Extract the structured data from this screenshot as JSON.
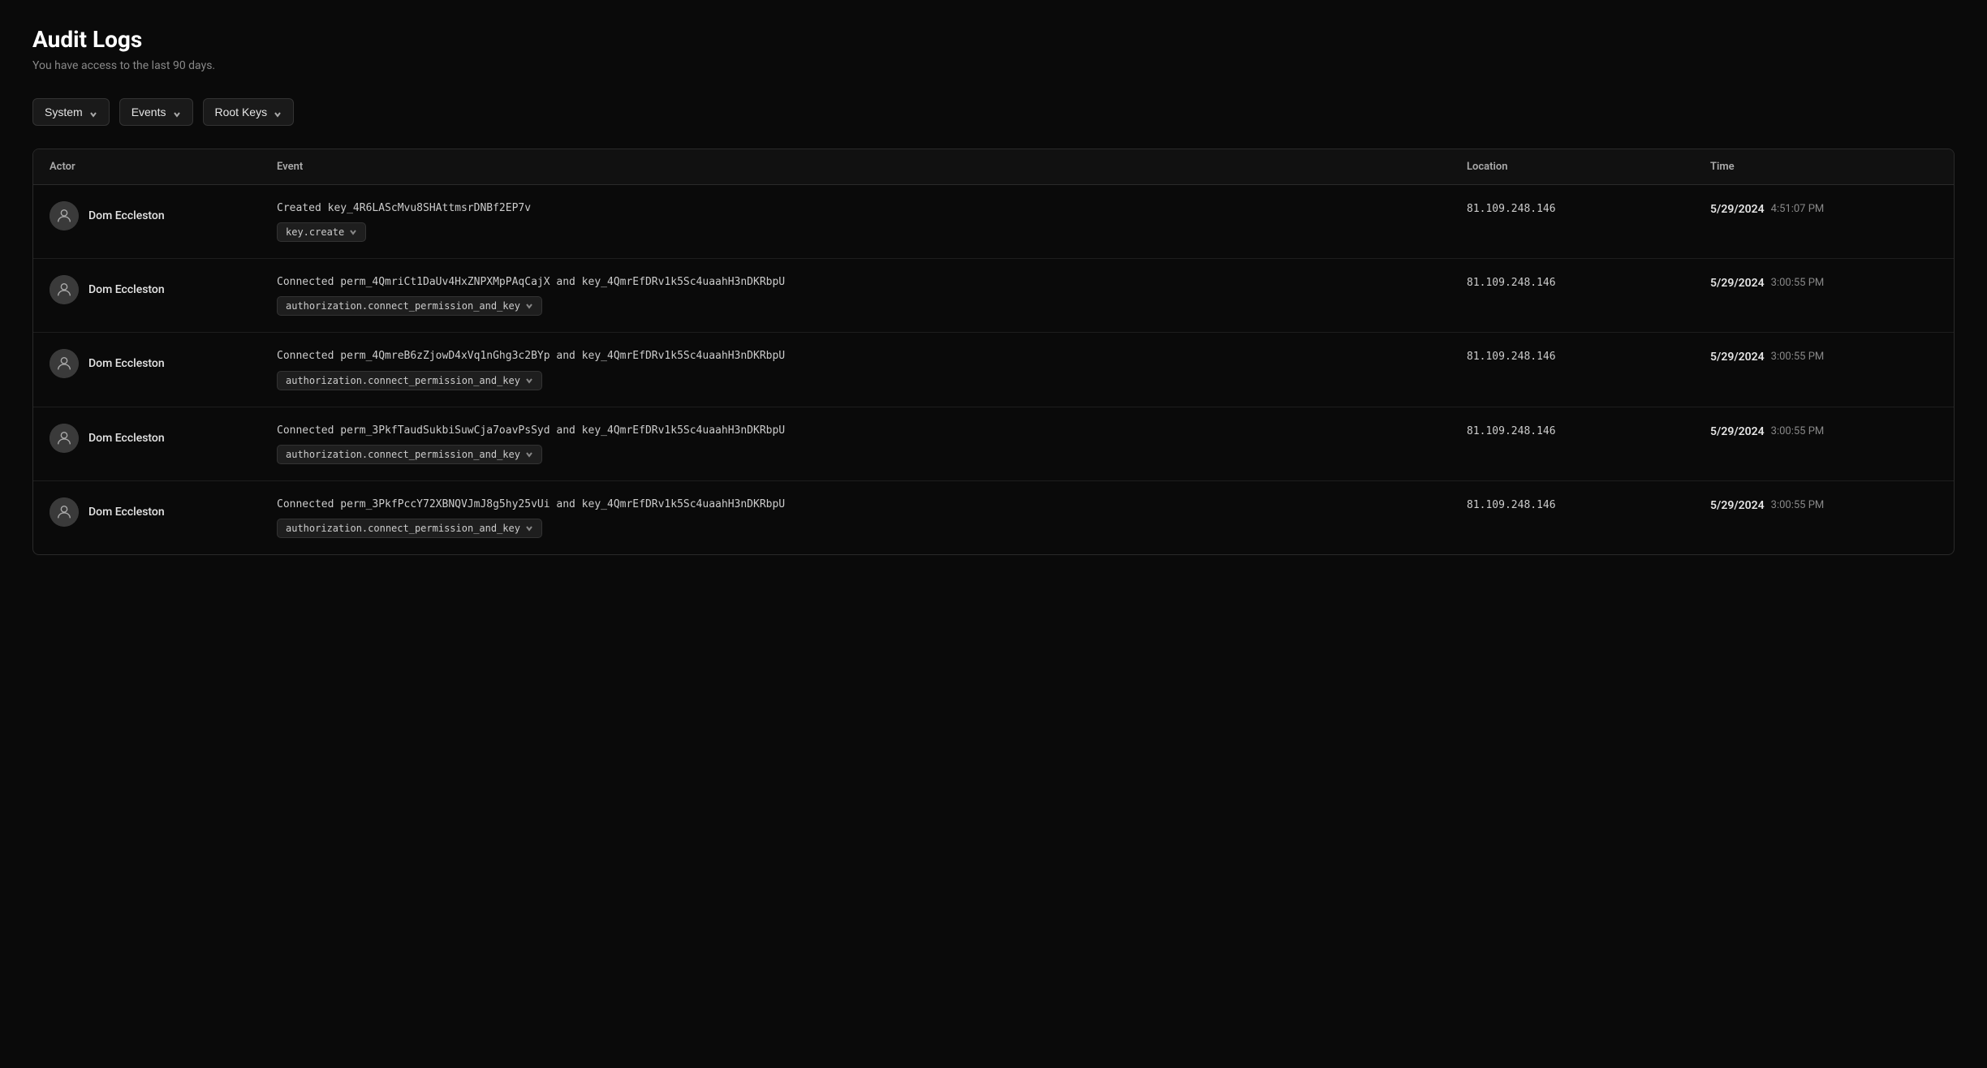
{
  "page": {
    "title": "Audit Logs",
    "subtitle": "You have access to the last 90 days."
  },
  "filters": [
    {
      "label": "System",
      "id": "system-filter"
    },
    {
      "label": "Events",
      "id": "events-filter"
    },
    {
      "label": "Root Keys",
      "id": "root-keys-filter"
    }
  ],
  "table": {
    "headers": [
      "Actor",
      "Event",
      "Location",
      "Time"
    ],
    "rows": [
      {
        "actor": "Dom Eccleston",
        "event_description": "Created key_4R6LAScMvu8SHAttmsrDNBf2EP7v",
        "event_badge": "key.create",
        "location": "81.109.248.146",
        "date": "5/29/2024",
        "time": "4:51:07 PM"
      },
      {
        "actor": "Dom Eccleston",
        "event_description": "Connected perm_4QmriCt1DaUv4HxZNPXMpPAqCajX and key_4QmrEfDRv1k5Sc4uaahH3nDKRbpU",
        "event_badge": "authorization.connect_permission_and_key",
        "location": "81.109.248.146",
        "date": "5/29/2024",
        "time": "3:00:55 PM"
      },
      {
        "actor": "Dom Eccleston",
        "event_description": "Connected perm_4QmreB6zZjowD4xVq1nGhg3c2BYp and key_4QmrEfDRv1k5Sc4uaahH3nDKRbpU",
        "event_badge": "authorization.connect_permission_and_key",
        "location": "81.109.248.146",
        "date": "5/29/2024",
        "time": "3:00:55 PM"
      },
      {
        "actor": "Dom Eccleston",
        "event_description": "Connected perm_3PkfTaudSukbiSuwCja7oavPsSyd and key_4QmrEfDRv1k5Sc4uaahH3nDKRbpU",
        "event_badge": "authorization.connect_permission_and_key",
        "location": "81.109.248.146",
        "date": "5/29/2024",
        "time": "3:00:55 PM"
      },
      {
        "actor": "Dom Eccleston",
        "event_description": "Connected perm_3PkfPccY72XBNQVJmJ8g5hy25vUi and key_4QmrEfDRv1k5Sc4uaahH3nDKRbpU",
        "event_badge": "authorization.connect_permission_and_key",
        "location": "81.109.248.146",
        "date": "5/29/2024",
        "time": "3:00:55 PM"
      }
    ]
  }
}
